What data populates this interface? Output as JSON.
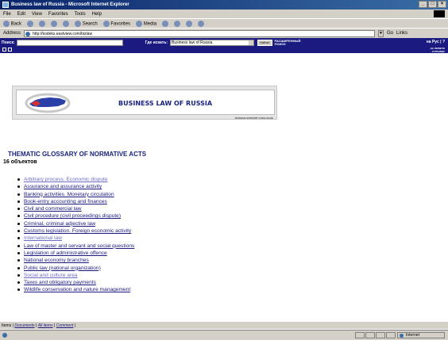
{
  "window": {
    "title": "Business law of Russia - Microsoft Internet Explorer",
    "controls": [
      "_",
      "□",
      "×"
    ]
  },
  "menu": {
    "items": [
      "File",
      "Edit",
      "View",
      "Favorites",
      "Tools",
      "Help"
    ]
  },
  "toolbar": {
    "back": "Back",
    "search": "Search",
    "favorites": "Favorites",
    "media": "Media"
  },
  "address": {
    "label": "Address",
    "url": "http://kodeks.eastview.com/bizlaw",
    "go": "Go",
    "links": "Links"
  },
  "site_search": {
    "label": "Поиск:",
    "value": "",
    "where_label": "Где искать:",
    "where_value": "Business law of Russia",
    "find_button": "Найти!",
    "advanced": "РАСШИРЕННЫЙ ПОИСК",
    "lang": "на Рус",
    "help": "?"
  },
  "subbar": {
    "back_to_page": "НА ПЕРВУЮ СТРАНИЦУ"
  },
  "banner": {
    "title": "BUSINESS LAW OF RUSSIA",
    "caption": "RUSSIAN SUPPORT CATALOGUE"
  },
  "content": {
    "title": "THEMATIC GLOSSARY OF NORMATIVE ACTS",
    "count": "16 объектов",
    "topics": [
      {
        "label": "Arbitrary process. Economic dispute",
        "visited": true
      },
      {
        "label": "Assurance and assurance activity",
        "visited": false
      },
      {
        "label": "Banking activities. Monetary circulation",
        "visited": false
      },
      {
        "label": "Book-entry accounting and finances",
        "visited": false
      },
      {
        "label": "Civil and commercial law",
        "visited": false
      },
      {
        "label": "Civil procedure (civil proceedings dispute)",
        "visited": false
      },
      {
        "label": "Criminal, criminal adjective law",
        "visited": false
      },
      {
        "label": "Customs legislation. Foreign economic activity",
        "visited": false
      },
      {
        "label": "International law",
        "visited": true
      },
      {
        "label": "Law of master and servant and social questions",
        "visited": false
      },
      {
        "label": "Legislation of administrative offence",
        "visited": false
      },
      {
        "label": "National economy branches",
        "visited": false
      },
      {
        "label": "Public law (national organization)",
        "visited": false
      },
      {
        "label": "Social and culture area",
        "visited": true
      },
      {
        "label": "Taxes and obligatory payments",
        "visited": false
      },
      {
        "label": "Wildlife conservation and nature management",
        "visited": false
      }
    ]
  },
  "footer": {
    "prefix": "Items |",
    "links": [
      "Documents",
      "All items",
      "Comment"
    ]
  },
  "status": {
    "zone": "Internet"
  }
}
